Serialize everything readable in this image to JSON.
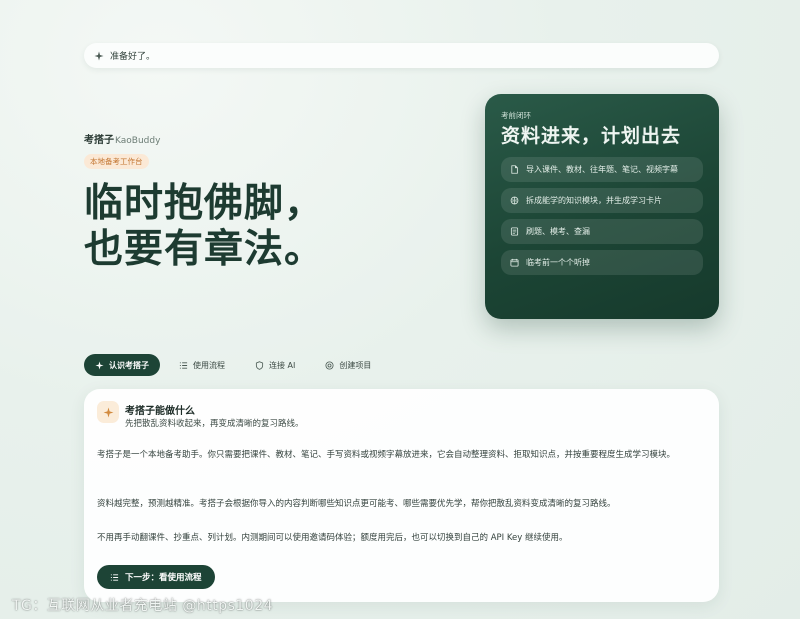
{
  "status": {
    "text": "准备好了。",
    "icon": "sparkle-icon"
  },
  "brand": {
    "name_cn": "考搭子",
    "name_en": "KaoBuddy"
  },
  "badge": "本地备考工作台",
  "hero": {
    "line1": "临时抱佛脚，",
    "line2": "也要有章法。"
  },
  "card": {
    "kicker": "考前闭环",
    "title": "资料进来，计划出去",
    "steps": [
      {
        "icon": "file-icon",
        "label": "导入课件、教材、往年题、笔记、视频字幕"
      },
      {
        "icon": "brain-icon",
        "label": "拆成能学的知识模块，并生成学习卡片"
      },
      {
        "icon": "quiz-icon",
        "label": "刷题、模考、查漏"
      },
      {
        "icon": "calendar-icon",
        "label": "临考前一个个听掉"
      }
    ]
  },
  "tabs": [
    {
      "label": "认识考搭子",
      "icon": "sparkle-icon",
      "active": true
    },
    {
      "label": "使用流程",
      "icon": "list-icon",
      "active": false
    },
    {
      "label": "连接 AI",
      "icon": "shield-icon",
      "active": false
    },
    {
      "label": "创建项目",
      "icon": "target-icon",
      "active": false
    }
  ],
  "panel": {
    "title": "考搭子能做什么",
    "subtitle": "先把散乱资料收起来，再变成清晰的复习路线。",
    "p1": "考搭子是一个本地备考助手。你只需要把课件、教材、笔记、手写资料或视频字幕放进来，它会自动整理资料、拒取知识点，并按重要程度生成学习模块。",
    "p2": "资料越完整，预测越精准。考搭子会根据你导入的内容判断哪些知识点更可能考、哪些需要优先学，帮你把散乱资料变成清晰的复习路线。",
    "p3": "不用再手动翻课件、抄重点、列计划。内测期间可以使用邀请码体验；额度用完后，也可以切换到自己的 API Key 继续使用。",
    "next_button": "下一步：看使用流程"
  },
  "watermark": "TG：互联网从业者充电站 @https1024",
  "colors": {
    "accent": "#1d4436",
    "badge_bg": "#fbe9d6",
    "badge_text": "#c2742f"
  }
}
